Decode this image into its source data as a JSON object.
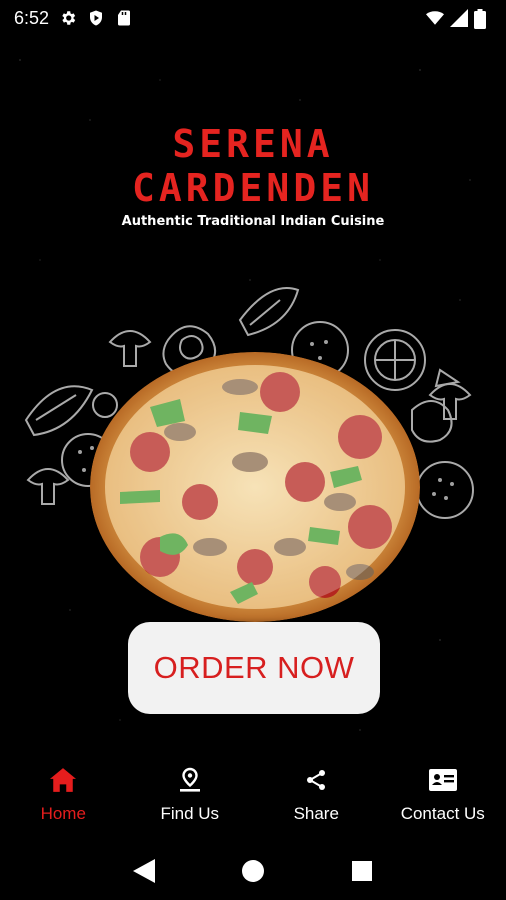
{
  "status_bar": {
    "time": "6:52",
    "icons_left": [
      "gear-icon",
      "play-protect-icon",
      "sd-card-icon"
    ],
    "icons_right": [
      "wifi-icon",
      "signal-icon",
      "battery-icon"
    ]
  },
  "brand": {
    "line1": "SERENA",
    "line2": "CARDENDEN",
    "tagline": "Authentic Traditional Indian Cuisine",
    "accent_color": "#e52420"
  },
  "hero": {
    "image": "pizza-illustration"
  },
  "order_button": {
    "label": "ORDER NOW",
    "text_color": "#d71f1f",
    "bg_color": "#f2f2f2"
  },
  "bottom_nav": {
    "items": [
      {
        "label": "Home",
        "icon": "home-icon",
        "active": true
      },
      {
        "label": "Find Us",
        "icon": "location-pin-icon",
        "active": false
      },
      {
        "label": "Share",
        "icon": "share-icon",
        "active": false
      },
      {
        "label": "Contact Us",
        "icon": "contact-card-icon",
        "active": false
      }
    ],
    "active_color": "#e51d1d"
  },
  "system_nav": {
    "buttons": [
      "back-icon",
      "home-circle-icon",
      "recents-icon"
    ]
  }
}
